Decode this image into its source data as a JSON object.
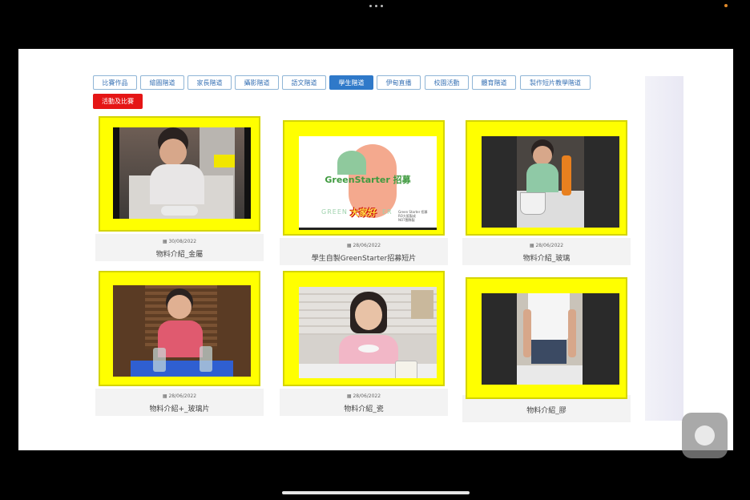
{
  "tabs": [
    {
      "label": "比賽作品",
      "active": false
    },
    {
      "label": "繪圖階道",
      "active": false
    },
    {
      "label": "家長階道",
      "active": false
    },
    {
      "label": "攝影階道",
      "active": false
    },
    {
      "label": "語文階道",
      "active": false
    },
    {
      "label": "學生階道",
      "active": true
    },
    {
      "label": "伊甸直播",
      "active": false
    },
    {
      "label": "校園活動",
      "active": false
    },
    {
      "label": "體育階道",
      "active": false
    },
    {
      "label": "製作短片教學階道",
      "active": false
    }
  ],
  "red_tab": {
    "label": "活動及比賽"
  },
  "videos": [
    {
      "date": "30/08/2022",
      "title": "物料介紹_金屬"
    },
    {
      "date": "28/06/2022",
      "title": "學生自製GreenStarter招募短片"
    },
    {
      "date": "28/06/2022",
      "title": "物料介紹_玻璃"
    },
    {
      "date": "28/06/2022",
      "title": "物料介紹+_玻璃片"
    },
    {
      "date": "28/06/2022",
      "title": "物料介紹_瓷"
    },
    {
      "date": "",
      "title": "物料介紹_膠"
    }
  ],
  "poster": {
    "brand": "GreenStarter",
    "heading": "招募",
    "banner": "大家好",
    "watermark": "GREEN",
    "watermark_end": "ER",
    "side_text": [
      "Green Starter 招募",
      "RO大阪製成",
      "NO7團隊製"
    ]
  },
  "colors": {
    "frame": "#ffff00",
    "active_tab": "#2f79c9",
    "red_tab": "#e51515"
  }
}
